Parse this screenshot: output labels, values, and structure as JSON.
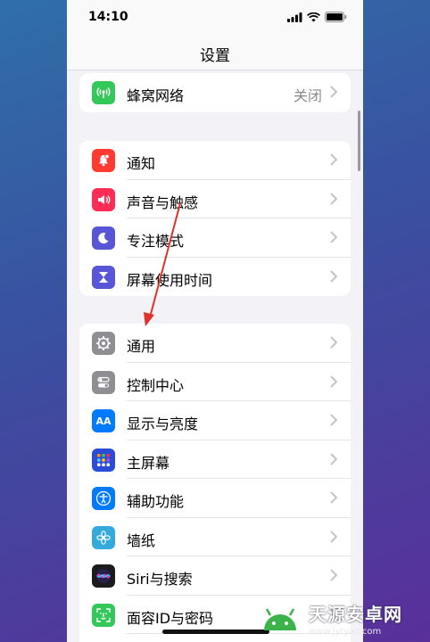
{
  "status_bar": {
    "time": "14:10"
  },
  "nav": {
    "title": "设置"
  },
  "group_network": [
    {
      "label": "蜂窝网络",
      "value": "关闭",
      "icon": "cellular-icon",
      "color": "#34c759"
    }
  ],
  "group_notify": [
    {
      "label": "通知",
      "icon": "bell-icon",
      "color": "#ff3b30"
    },
    {
      "label": "声音与触感",
      "icon": "speaker-icon",
      "color": "#ff2d55"
    },
    {
      "label": "专注模式",
      "icon": "moon-icon",
      "color": "#5856d6"
    },
    {
      "label": "屏幕使用时间",
      "icon": "hourglass-icon",
      "color": "#5856d6"
    }
  ],
  "group_general": [
    {
      "label": "通用",
      "icon": "gear-icon",
      "color": "#8e8e93"
    },
    {
      "label": "控制中心",
      "icon": "toggle-icon",
      "color": "#8e8e93"
    },
    {
      "label": "显示与亮度",
      "icon": "text-size-icon",
      "color": "#007aff"
    },
    {
      "label": "主屏幕",
      "icon": "grid-icon",
      "color": "#2c4bd6"
    },
    {
      "label": "辅助功能",
      "icon": "accessibility-icon",
      "color": "#007aff"
    },
    {
      "label": "墙纸",
      "icon": "flower-icon",
      "color": "#34aadc"
    },
    {
      "label": "Siri与搜索",
      "icon": "siri-icon",
      "color": "#1c1c1e"
    },
    {
      "label": "面容ID与密码",
      "icon": "faceid-icon",
      "color": "#34c759"
    }
  ],
  "watermark": {
    "title": "天源安卓网",
    "url": "www.jytyaz.com"
  }
}
